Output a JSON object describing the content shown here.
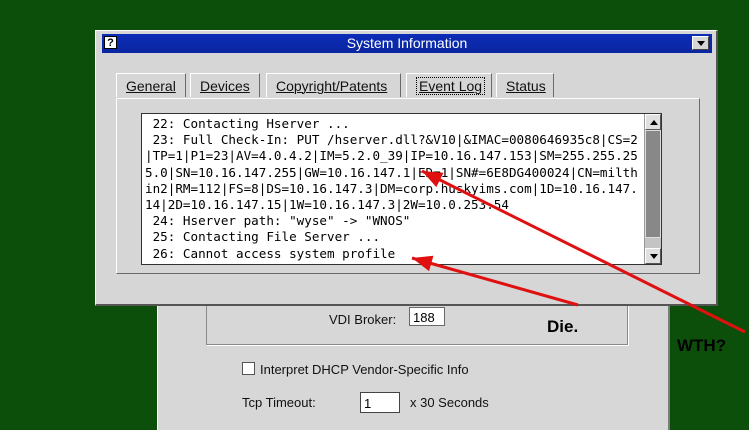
{
  "window": {
    "title": "System Information",
    "help_glyph": "?"
  },
  "tabs": [
    {
      "label": "General"
    },
    {
      "label": "Devices"
    },
    {
      "label": "Copyright/Patents"
    },
    {
      "label": "Event Log"
    },
    {
      "label": "Status"
    }
  ],
  "active_tab": "Event Log",
  "event_log": {
    "text": " 22: Contacting Hserver ...\n 23: Full Check-In: PUT /hserver.dll?&V10|&IMAC=0080646935c8|CS=2|TP=1|P1=23|AV=4.0.4.2|IM=5.2.0_39|IP=10.16.147.153|SM=255.255.255.0|SN=10.16.147.255|GW=10.16.147.1|ED=1|SN#=6E8DG400024|CN=milthin2|RM=112|FS=8|DS=10.16.147.3|DM=corp.huskyims.com|1D=10.16.147.14|2D=10.16.147.15|1W=10.16.147.3|2W=10.0.253.54\n 24: Hserver path: \"wyse\" -> \"WNOS\"\n 25: Contacting File Server ...\n 26: Cannot access system profile"
  },
  "background_dialog": {
    "vdi_broker_label": "VDI Broker:",
    "vdi_broker_value": "188",
    "dhcp_label": "Interpret DHCP Vendor-Specific Info",
    "dhcp_checked": false,
    "tcp_timeout_label": "Tcp Timeout:",
    "tcp_timeout_value": "1",
    "tcp_timeout_unit": "x 30 Seconds"
  },
  "annotations": {
    "die": "Die.",
    "wth": "WTH?",
    "arrow_color": "#e01010"
  }
}
